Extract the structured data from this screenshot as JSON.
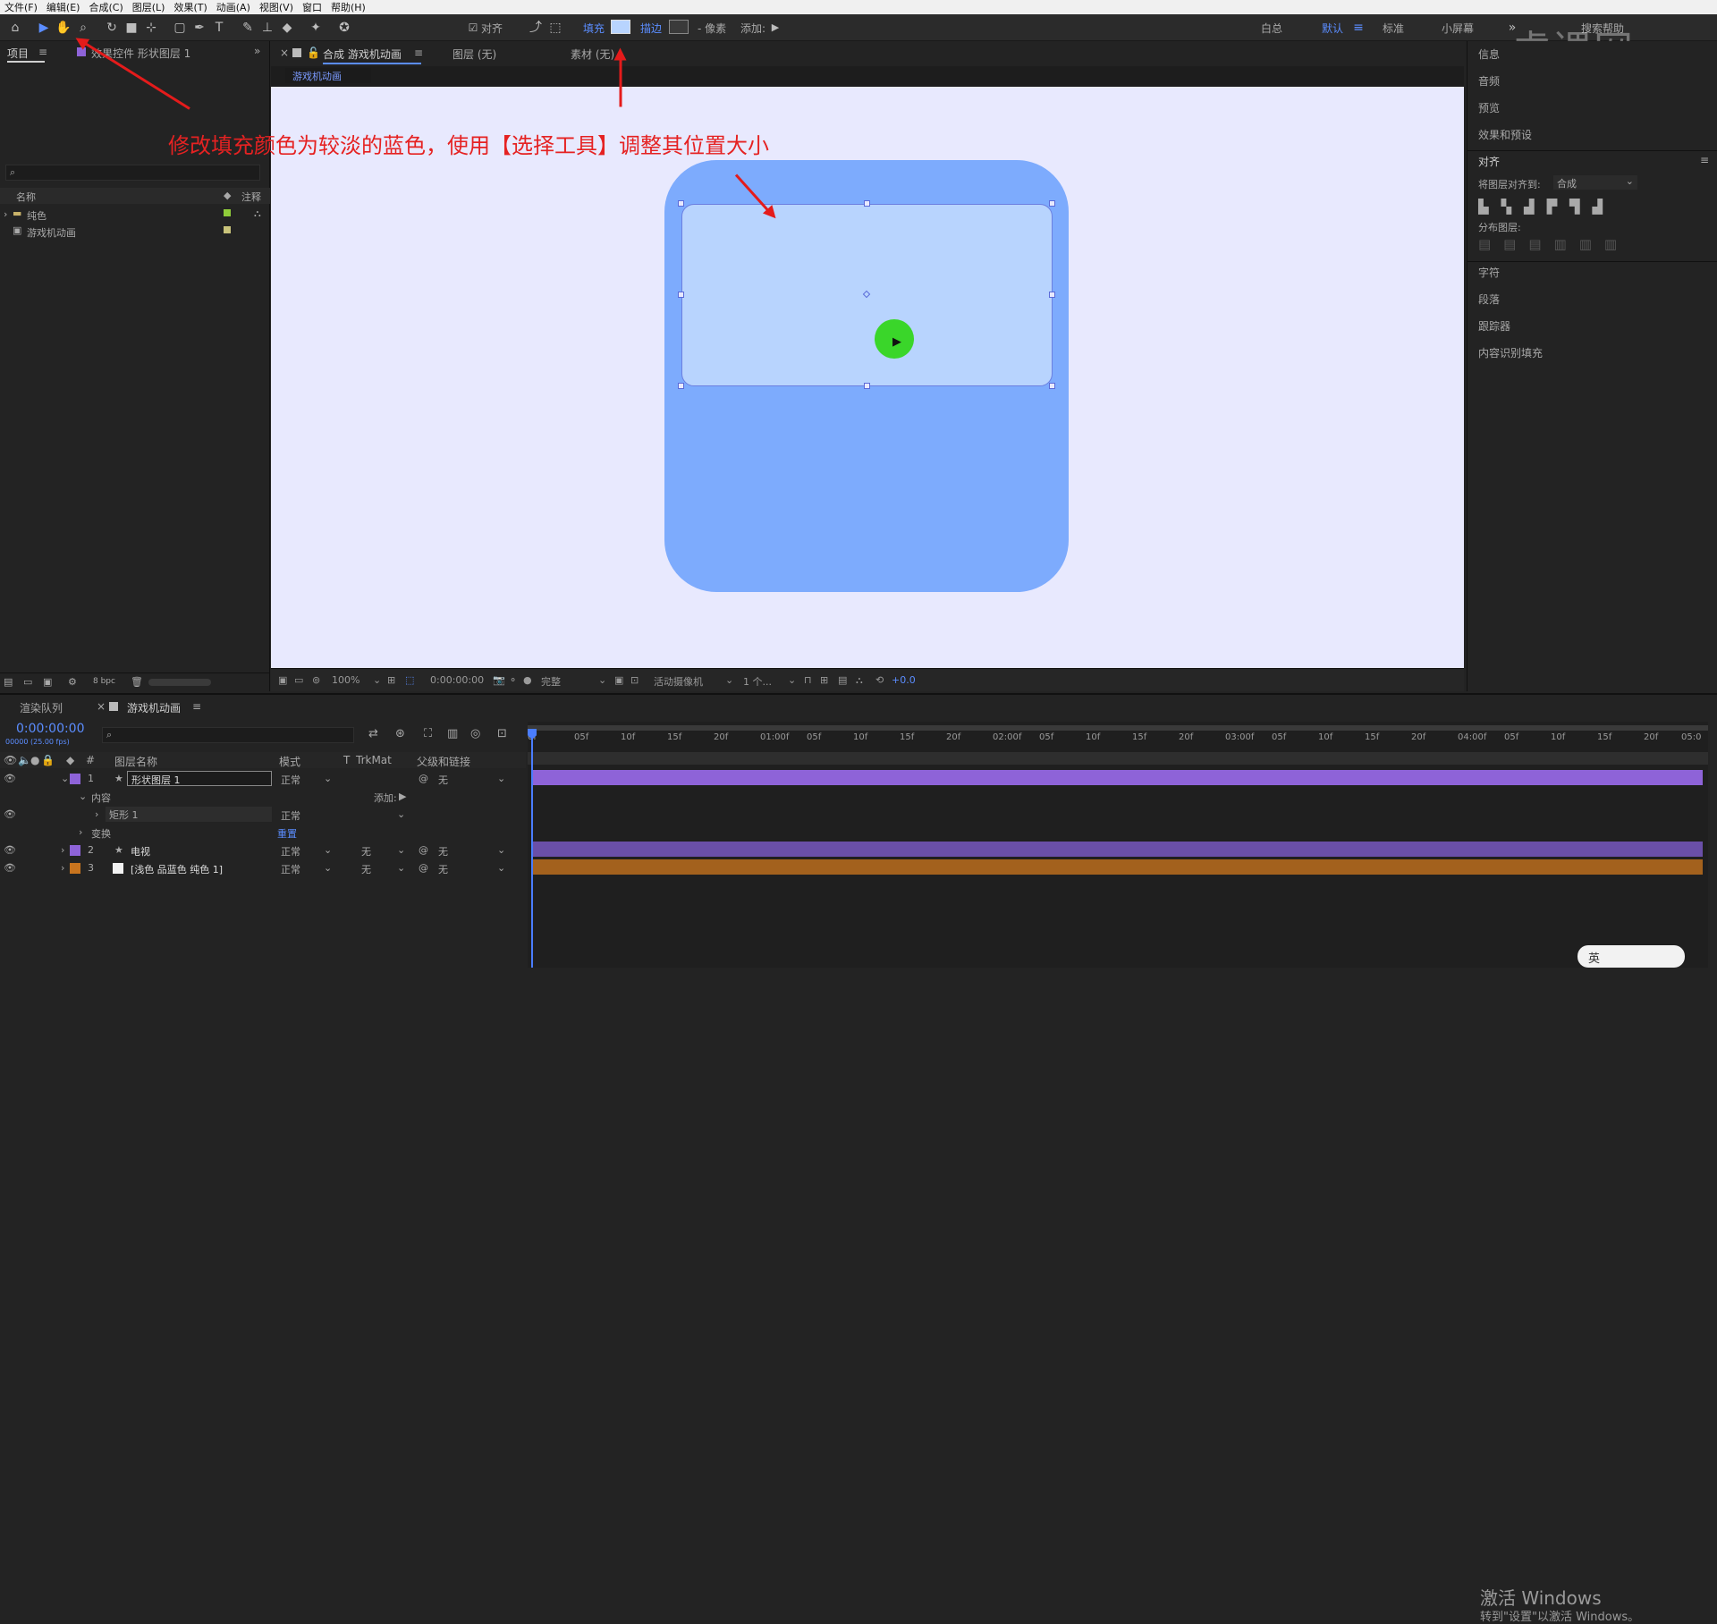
{
  "menu": [
    "文件(F)",
    "编辑(E)",
    "合成(C)",
    "图层(L)",
    "效果(T)",
    "动画(A)",
    "视图(V)",
    "窗口",
    "帮助(H)"
  ],
  "toolbar": {
    "align_label": "对齐",
    "fill_label": "填充",
    "stroke_label": "描边",
    "pixels_label": "- 像素",
    "add_label": "添加:",
    "fill_color": "#b8d4fe",
    "workspaces": [
      "白总",
      "默认",
      "标准",
      "小屏幕"
    ],
    "search_help": "搜索帮助"
  },
  "watermark_logo": "虎课网",
  "left_panel": {
    "tab_project": "项目",
    "tab_effects": "效果控件 形状图层 1",
    "col_name": "名称",
    "col_comment": "注释",
    "items": [
      {
        "label": "纯色",
        "color": "#8fcc3a"
      },
      {
        "label": "游戏机动画",
        "color": "#c9c37a"
      }
    ],
    "bpc": "8 bpc"
  },
  "viewer": {
    "tab_comp": "合成 游戏机动画",
    "tab_layer": "图层 (无)",
    "tab_footage": "素材 (无)",
    "comp_chip": "游戏机动画",
    "annotation": "修改填充颜色为较淡的蓝色，使用【选择工具】调整其位置大小",
    "footer": {
      "zoom": "100%",
      "time": "0:00:00:00",
      "quality": "完整",
      "camera": "活动摄像机",
      "views": "1 个...",
      "exposure": "+0.0"
    }
  },
  "right_panel": {
    "items": [
      "信息",
      "音频",
      "预览",
      "效果和预设"
    ],
    "align_title": "对齐",
    "align_to_label": "将图层对齐到:",
    "align_to_value": "合成",
    "distribute_label": "分布图层:",
    "items2": [
      "字符",
      "段落",
      "跟踪器",
      "内容识别填充"
    ]
  },
  "timeline": {
    "tab_render": "渲染队列",
    "tab_comp": "游戏机动画",
    "timecode": "0:00:00:00",
    "fps": "00000 (25.00 fps)",
    "col_layer_name": "图层名称",
    "col_mode": "模式",
    "col_t": "T",
    "col_trkmat": "TrkMat",
    "col_parent": "父级和链接",
    "ruler": [
      "0f",
      "05f",
      "10f",
      "15f",
      "20f",
      "01:00f",
      "05f",
      "10f",
      "15f",
      "20f",
      "02:00f",
      "05f",
      "10f",
      "15f",
      "20f",
      "03:00f",
      "05f",
      "10f",
      "15f",
      "20f",
      "04:00f",
      "05f",
      "10f",
      "15f",
      "20f",
      "05:0"
    ],
    "layers": [
      {
        "num": "1",
        "name": "形状图层 1",
        "mode": "正常",
        "trkmat": "",
        "parent": "无",
        "color": "#8e63d8",
        "bar": "#8e63d8"
      },
      {
        "num": "2",
        "name": "电视",
        "mode": "正常",
        "trkmat": "无",
        "parent": "无",
        "color": "#8e63d8",
        "bar": "#6a4fa8"
      },
      {
        "num": "3",
        "name": "[浅色 品蓝色 纯色 1]",
        "mode": "正常",
        "trkmat": "无",
        "parent": "无",
        "color": "#c8741e",
        "bar": "#a3611d"
      }
    ],
    "sub_contents": "内容",
    "sub_add": "添加:",
    "sub_rect": "矩形 1",
    "sub_rect_mode": "正常",
    "sub_transform": "变换",
    "sub_reset": "重置"
  },
  "windows_activation": {
    "title": "激活 Windows",
    "subtitle": "转到\"设置\"以激活 Windows。"
  },
  "ime": "英"
}
